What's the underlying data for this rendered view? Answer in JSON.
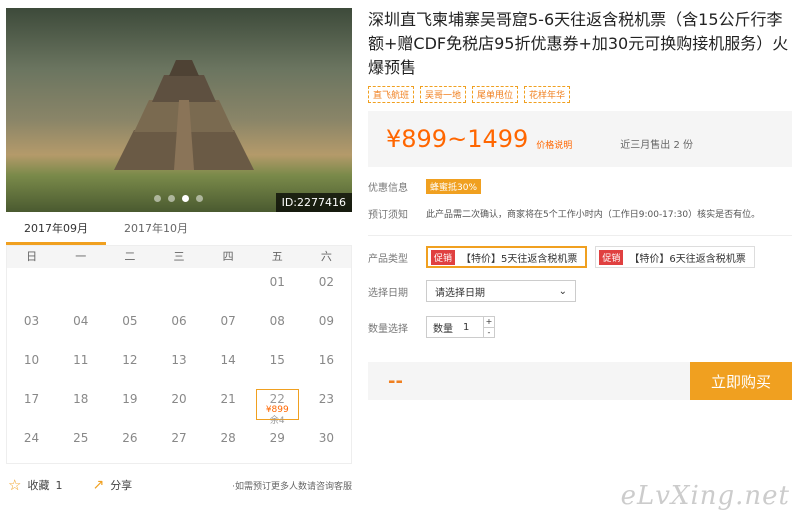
{
  "photo": {
    "id_label": "ID:2277416",
    "dots": 4,
    "active_dot": 2
  },
  "calendar": {
    "tabs": [
      {
        "label": "2017年09月",
        "active": true
      },
      {
        "label": "2017年10月",
        "active": false
      }
    ],
    "weekdays": [
      "日",
      "一",
      "二",
      "三",
      "四",
      "五",
      "六"
    ],
    "cells": [
      {
        "day": ""
      },
      {
        "day": ""
      },
      {
        "day": ""
      },
      {
        "day": ""
      },
      {
        "day": ""
      },
      {
        "day": "01"
      },
      {
        "day": "02"
      },
      {
        "day": "03"
      },
      {
        "day": "04"
      },
      {
        "day": "05"
      },
      {
        "day": "06"
      },
      {
        "day": "07"
      },
      {
        "day": "08"
      },
      {
        "day": "09"
      },
      {
        "day": "10"
      },
      {
        "day": "11"
      },
      {
        "day": "12"
      },
      {
        "day": "13"
      },
      {
        "day": "14"
      },
      {
        "day": "15"
      },
      {
        "day": "16"
      },
      {
        "day": "17"
      },
      {
        "day": "18"
      },
      {
        "day": "19"
      },
      {
        "day": "20"
      },
      {
        "day": "21"
      },
      {
        "day": "22",
        "price": "¥899",
        "stock": "余4",
        "selected": true
      },
      {
        "day": "23"
      },
      {
        "day": "24"
      },
      {
        "day": "25"
      },
      {
        "day": "26"
      },
      {
        "day": "27"
      },
      {
        "day": "28"
      },
      {
        "day": "29"
      },
      {
        "day": "30"
      }
    ]
  },
  "share": {
    "favorite_label": "收藏",
    "favorite_count": "1",
    "share_label": "分享",
    "note": "如需预订更多人数请咨询客服"
  },
  "product": {
    "title": "深圳直飞柬埔寨吴哥窟5-6天往返含税机票（含15公斤行李额+赠CDF免税店95折优惠券+加30元可换购接机服务）火爆预售",
    "tags": [
      "直飞航班",
      "吴哥一地",
      "尾单甩位",
      "花样年华"
    ],
    "price": "¥899~1499",
    "price_note": "价格说明",
    "sold": "近三月售出 2 份"
  },
  "info": {
    "promo_label": "优惠信息",
    "promo_badge": "蜂蜜抵30%",
    "booking_label": "预订须知",
    "booking_text": "此产品需二次确认，商家将在5个工作小时内（工作日9:00-17:30）核实是否有位。"
  },
  "options": {
    "type_label": "产品类型",
    "types": [
      {
        "badge": "促销",
        "label": "【特价】5天往返含税机票",
        "active": true
      },
      {
        "badge": "促销",
        "label": "【特价】6天往返含税机票",
        "active": false
      }
    ],
    "date_label": "选择日期",
    "date_value": "请选择日期",
    "qty_label": "数量选择",
    "qty_prefix": "数量",
    "qty_value": "1"
  },
  "buy": {
    "total": "--",
    "button": "立即购买"
  },
  "watermark": "eLvXing.net",
  "colors": {
    "accent": "#f0a020",
    "price": "#ff6600",
    "promo": "#e04040"
  }
}
